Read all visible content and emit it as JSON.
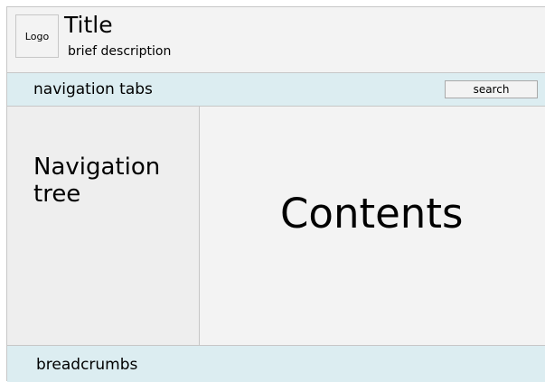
{
  "header": {
    "logo_label": "Logo",
    "title": "Title",
    "description": "brief description"
  },
  "navbar": {
    "tabs_label": "navigation tabs",
    "search_label": "search"
  },
  "sidebar": {
    "label": "Navigation tree"
  },
  "main": {
    "label": "Contents"
  },
  "footer": {
    "label": "breadcrumbs"
  }
}
